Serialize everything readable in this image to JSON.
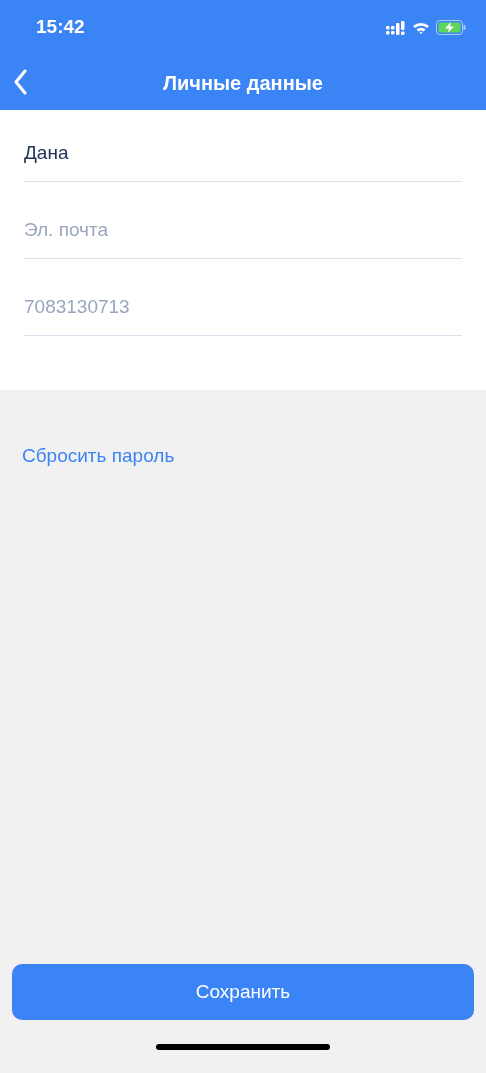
{
  "status_bar": {
    "time": "15:42"
  },
  "nav_bar": {
    "title": "Личные данные"
  },
  "fields": [
    {
      "value": "Дана"
    },
    {
      "placeholder": "Эл. почта"
    },
    {
      "placeholder": "7083130713"
    }
  ],
  "reset_link": "Сбросить пароль",
  "save_button": "Сохранить"
}
